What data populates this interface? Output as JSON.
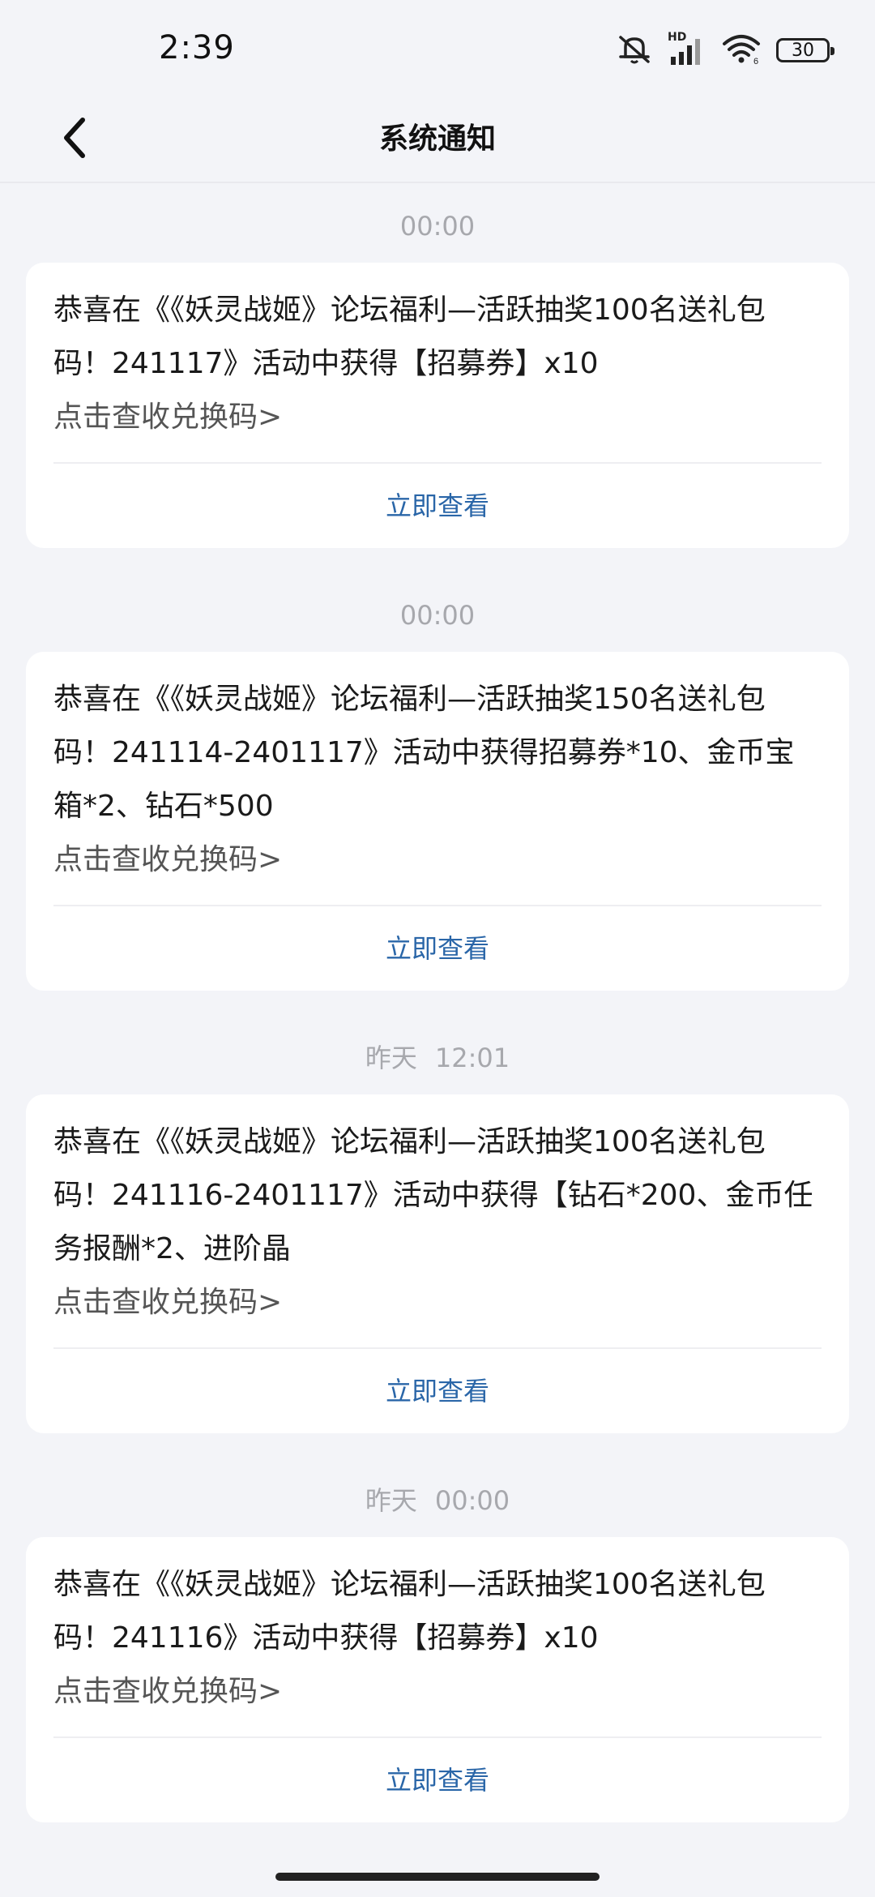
{
  "status_bar": {
    "time": "2:39",
    "battery": "30",
    "hd_label": "HD"
  },
  "header": {
    "title": "系统通知"
  },
  "notifications": [
    {
      "date": "",
      "time": "00:00",
      "message": "恭喜在《《妖灵战姬》论坛福利—活跃抽奖100名送礼包码！241117》活动中获得【招募券】x10",
      "link": "点击查收兑换码>",
      "action": "立即查看"
    },
    {
      "date": "",
      "time": "00:00",
      "message": "恭喜在《《妖灵战姬》论坛福利—活跃抽奖150名送礼包码！241114-2401117》活动中获得招募券*10、金币宝箱*2、钻石*500",
      "link": "点击查收兑换码>",
      "action": "立即查看"
    },
    {
      "date": "昨天",
      "time": "12:01",
      "message": "恭喜在《《妖灵战姬》论坛福利—活跃抽奖100名送礼包码！241116-2401117》活动中获得【钻石*200、金币任务报酬*2、进阶晶",
      "link": "点击查收兑换码>",
      "action": "立即查看"
    },
    {
      "date": "昨天",
      "time": "00:00",
      "message": "恭喜在《《妖灵战姬》论坛福利—活跃抽奖100名送礼包码！241116》活动中获得【招募券】x10",
      "link": "点击查收兑换码>",
      "action": "立即查看"
    }
  ]
}
